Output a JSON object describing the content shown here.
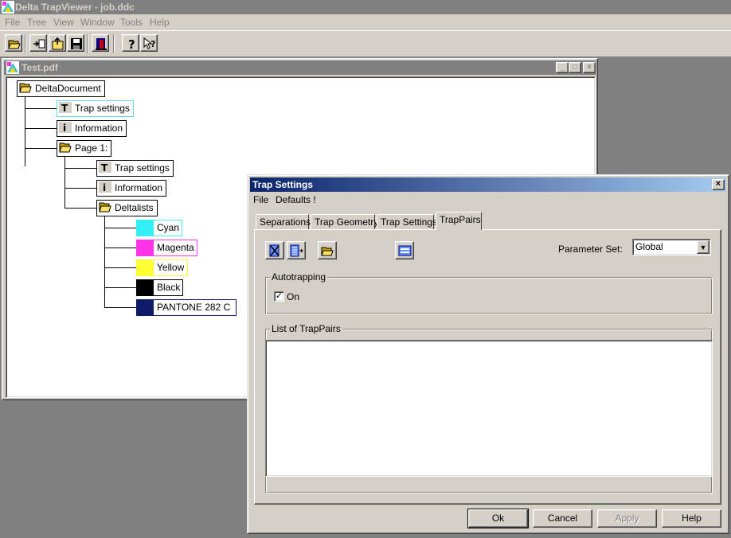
{
  "app": {
    "title": "Delta TrapViewer - job.ddc",
    "menu": [
      "File",
      "Tree",
      "View",
      "Window",
      "Tools",
      "Help"
    ],
    "toolbar_icons": [
      "open-folder-icon",
      "import-icon",
      "export-icon",
      "save-icon",
      "exit-icon",
      "help-icon",
      "context-help-icon"
    ]
  },
  "child_window": {
    "title": "Test.pdf",
    "controls": {
      "minimize": "_",
      "maximize": "□",
      "close": "×"
    },
    "tree": {
      "root": "DeltaDocument",
      "root_children": [
        "Trap settings",
        "Information"
      ],
      "page": "Page 1:",
      "page_children": [
        "Trap settings",
        "Information"
      ],
      "deltalists": "Deltalists",
      "separations": [
        {
          "name": "Cyan",
          "color": "#33f0f5"
        },
        {
          "name": "Magenta",
          "color": "#ff33e6"
        },
        {
          "name": "Yellow",
          "color": "#ffff33"
        },
        {
          "name": "Black",
          "color": "#000000"
        },
        {
          "name": "PANTONE 282 C",
          "color": "#0d1a66"
        }
      ]
    }
  },
  "dialog": {
    "title": "Trap Settings",
    "close": "×",
    "menu": [
      "File",
      "Defaults !"
    ],
    "tabs": [
      "Separations",
      "Trap Geometry",
      "Trap Settings",
      "TrapPairs"
    ],
    "active_tab": "TrapPairs",
    "parameter_set": {
      "label": "Parameter Set:",
      "value": "Global",
      "arrow": "▼"
    },
    "autotrapping": {
      "group_label": "Autotrapping",
      "checkbox_label": "On",
      "checked": true,
      "check_mark": "✓"
    },
    "list_label": "List of TrapPairs",
    "buttons": {
      "ok": "Ok",
      "cancel": "Cancel",
      "apply": "Apply",
      "help": "Help"
    }
  }
}
